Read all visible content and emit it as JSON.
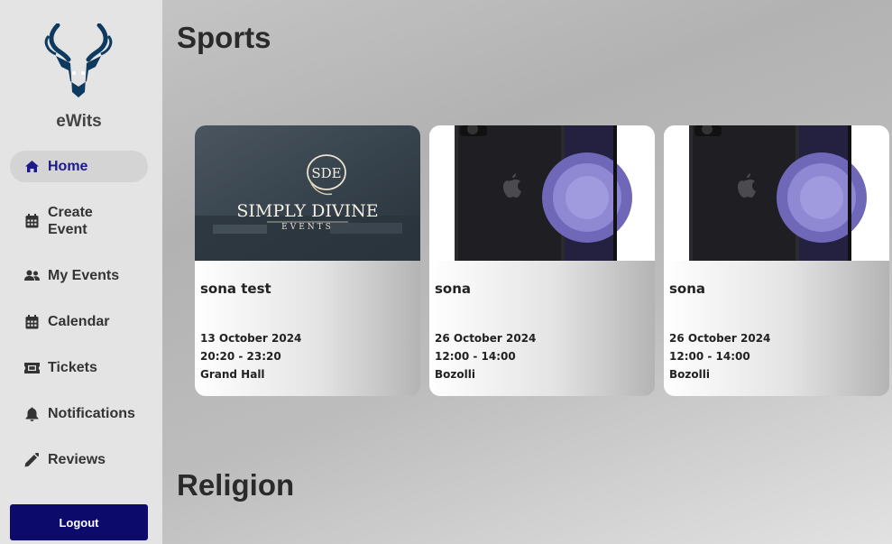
{
  "app": {
    "brand": "eWits"
  },
  "sidebar": {
    "items": [
      {
        "label": "Home",
        "icon": "home-icon",
        "active": true
      },
      {
        "label": "Create Event",
        "icon": "calendar-icon"
      },
      {
        "label": "My Events",
        "icon": "users-icon"
      },
      {
        "label": "Calendar",
        "icon": "calendar-icon"
      },
      {
        "label": "Tickets",
        "icon": "ticket-icon"
      },
      {
        "label": "Notifications",
        "icon": "bell-icon"
      },
      {
        "label": "Reviews",
        "icon": "pencil-icon"
      }
    ],
    "logout_label": "Logout"
  },
  "sections": [
    {
      "title": "Sports",
      "events": [
        {
          "name": "sona test",
          "date": "13 October 2024",
          "time": "20:20 - 23:20",
          "venue": "Grand Hall",
          "image": "simply-divine-events-logo"
        },
        {
          "name": "sona",
          "date": "26 October 2024",
          "time": "12:00 - 14:00",
          "venue": "Bozolli",
          "image": "phone-photo"
        },
        {
          "name": "sona",
          "date": "26 October 2024",
          "time": "12:00 - 14:00",
          "venue": "Bozolli",
          "image": "phone-photo"
        }
      ]
    },
    {
      "title": "Religion",
      "events": []
    }
  ],
  "thumb1": {
    "badge": "SDE",
    "line1": "SIMPLY DIVINE",
    "line2": "EVENTS"
  },
  "colors": {
    "accent": "#1c1a8e",
    "logout_bg": "#0c0a6a",
    "logo": "#0f3a5f"
  }
}
